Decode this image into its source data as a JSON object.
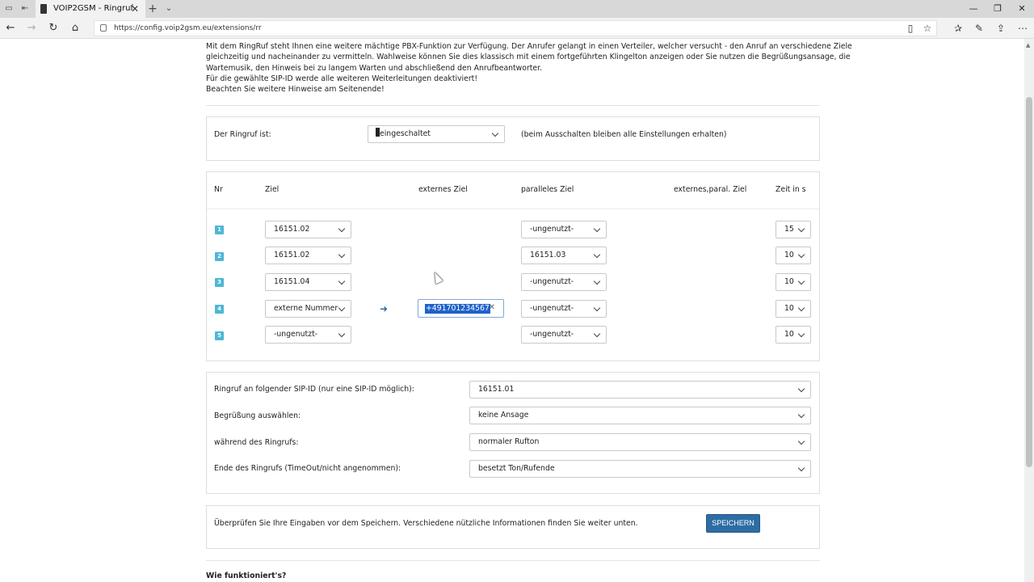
{
  "browser": {
    "tab_title": "VOIP2GSM - Ringruf",
    "url": "https://config.voip2gsm.eu/extensions/rr"
  },
  "intro": {
    "lines": [
      "Mit dem RingRuf steht Ihnen eine weitere mächtige PBX-Funktion zur Verfügung. Der Anrufer gelangt in einen Verteiler, welcher versucht - den Anruf an verschiedene Ziele",
      "gleichzeitig und nacheinander zu vermitteln. Wahlweise können Sie dies klassisch mit einem fortgeführten Klingelton anzeigen oder Sie nutzen die Begrüßungsansage, die",
      "Wartemusik, den Hinweis bei zu langem Warten und abschließend den Anrufbeantworter.",
      "Für die gewählte SIP-ID werde alle weiteren Weiterleitungen deaktiviert!",
      "Beachten Sie weitere Hinweise am Seitenende!"
    ]
  },
  "status": {
    "label": "Der Ringruf ist:",
    "value": "eingeschaltet",
    "note": "(beim Ausschalten bleiben alle Einstellungen erhalten)"
  },
  "table": {
    "headers": {
      "nr": "Nr",
      "ziel": "Ziel",
      "externes_ziel": "externes Ziel",
      "paralleles_ziel": "paralleles Ziel",
      "externes_paral_ziel": "externes,paral. Ziel",
      "zeit": "Zeit in s"
    },
    "rows": [
      {
        "nr": "1",
        "ziel": "16151.02",
        "parallel": "-ungenutzt-",
        "zeit": "15"
      },
      {
        "nr": "2",
        "ziel": "16151.02",
        "parallel": "16151.03",
        "zeit": "10"
      },
      {
        "nr": "3",
        "ziel": "16151.04",
        "parallel": "-ungenutzt-",
        "zeit": "10"
      },
      {
        "nr": "4",
        "ziel": "externe Nummer",
        "extern": "+491701234567",
        "parallel": "-ungenutzt-",
        "zeit": "10"
      },
      {
        "nr": "5",
        "ziel": "-ungenutzt-",
        "parallel": "-ungenutzt-",
        "zeit": "10"
      }
    ]
  },
  "settings": {
    "sip_label": "Ringruf an folgender SIP-ID (nur eine SIP-ID möglich):",
    "sip_value": "16151.01",
    "greeting_label": "Begrüßung auswählen:",
    "greeting_value": "keine Ansage",
    "during_label": "während des Ringrufs:",
    "during_value": "normaler Rufton",
    "end_label": "Ende des Ringrufs (TimeOut/nicht angenommen):",
    "end_value": "besetzt Ton/Rufende"
  },
  "save": {
    "hint": "Überprüfen Sie Ihre Eingaben vor dem Speichern. Verschiedene nützliche Informationen finden Sie weiter unten.",
    "button": "SPEICHERN"
  },
  "how": {
    "heading": "Wie funktioniert's?"
  }
}
